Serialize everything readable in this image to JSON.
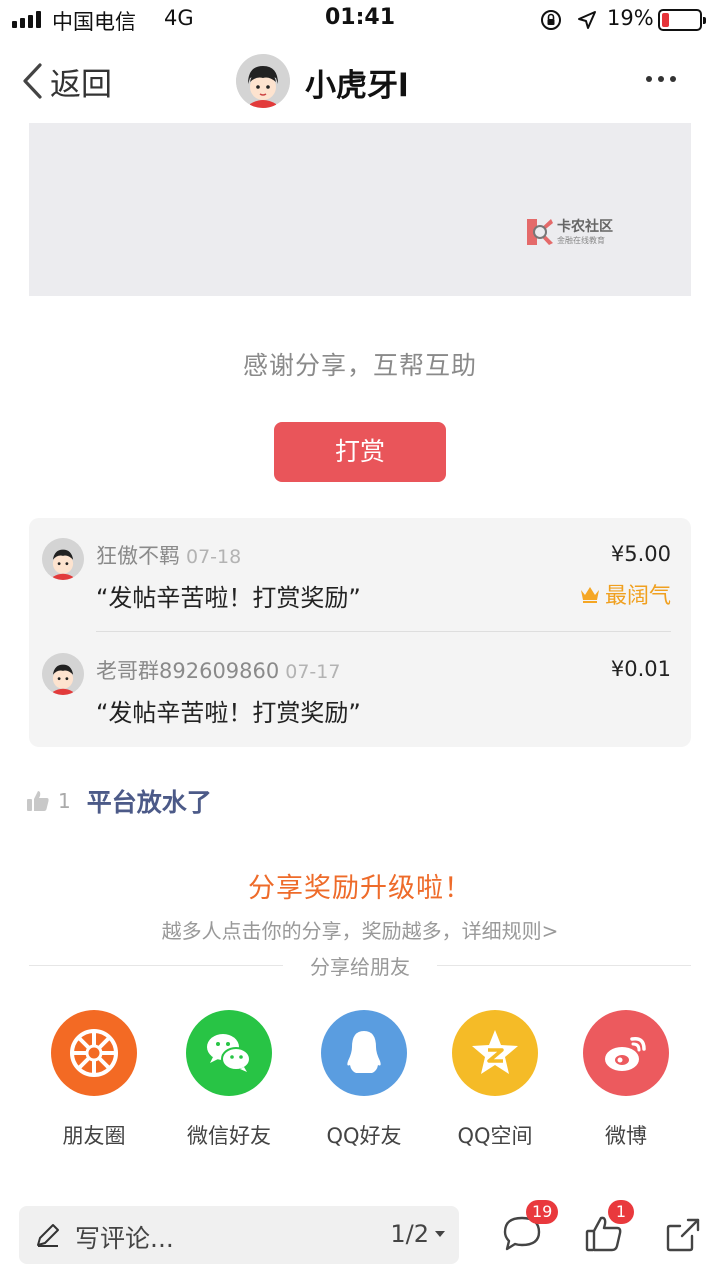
{
  "status_bar": {
    "carrier": "中国电信",
    "network": "4G",
    "time": "01:41",
    "battery_percent": "19%",
    "battery_level": 0.19,
    "battery_color": "#e5343a"
  },
  "nav": {
    "back_label": "返回",
    "title": "小虎牙l",
    "icons": [
      "chevron-left-icon",
      "more-icon"
    ]
  },
  "watermark": {
    "title": "卡农社区",
    "subtitle": "金融在线教育"
  },
  "reward": {
    "thanks_text": "感谢分享，互帮互助",
    "button_label": "打赏",
    "button_color": "#e9555a",
    "items": [
      {
        "name": "狂傲不羁",
        "date": "07-18",
        "message": "“发帖辛苦啦！打赏奖励”",
        "amount": "¥5.00",
        "badge": "最阔气"
      },
      {
        "name": "老哥群892609860",
        "date": "07-17",
        "message": "“发帖辛苦啦！打赏奖励”",
        "amount": "¥0.01"
      }
    ]
  },
  "like": {
    "count": "1",
    "text": "平台放水了"
  },
  "share": {
    "title": "分享奖励升级啦！",
    "subtitle": "越多人点击你的分享，奖励越多，详细规则>",
    "divider_text": "分享给朋友",
    "targets": [
      {
        "label": "朋友圈",
        "icon": "moments-icon",
        "color": "#f36a24"
      },
      {
        "label": "微信好友",
        "icon": "wechat-icon",
        "color": "#28c445"
      },
      {
        "label": "QQ好友",
        "icon": "qq-icon",
        "color": "#5a9de0"
      },
      {
        "label": "QQ空间",
        "icon": "qzone-icon",
        "color": "#f5bb27"
      },
      {
        "label": "微博",
        "icon": "weibo-icon",
        "color": "#ec5a5e"
      }
    ]
  },
  "bottom_bar": {
    "comment_placeholder": "写评论...",
    "page_indicator": "1/2",
    "comment_badge": "19",
    "like_badge": "1",
    "icons": [
      "pencil-icon",
      "comment-icon",
      "thumbs-up-icon",
      "share-icon"
    ]
  }
}
